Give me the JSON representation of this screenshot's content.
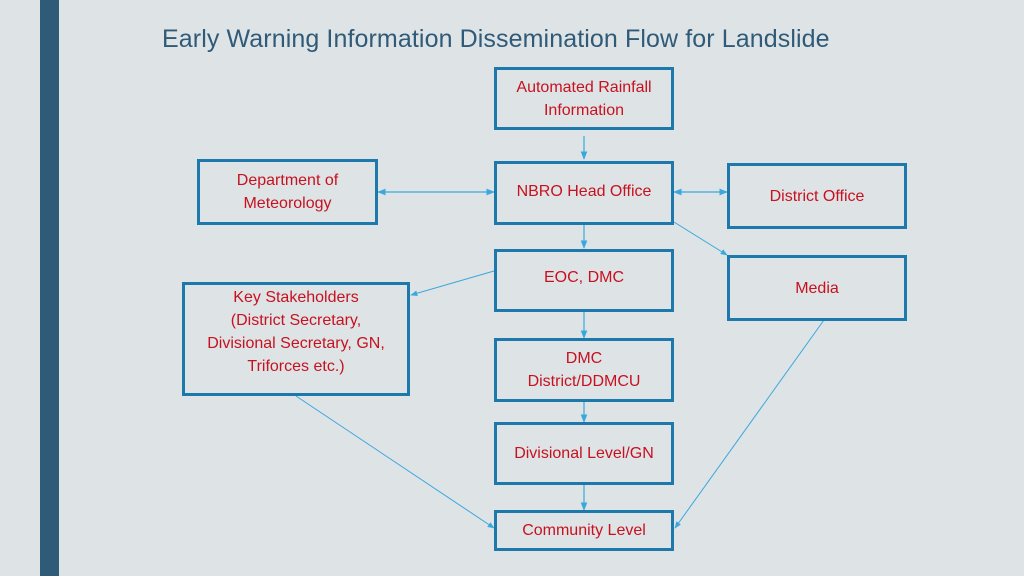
{
  "title": "Early Warning Information Dissemination Flow for Landslide",
  "colors": {
    "accent_bar": "#2f5a78",
    "title_text": "#2f5a78",
    "box_border": "#1d79ab",
    "box_text": "#c8111f",
    "connector": "#3aa8dc",
    "background": "#dee3e6"
  },
  "nodes": {
    "rainfall": "Automated Rainfall\nInformation",
    "meteorology": "Department of\nMeteorology",
    "nbro": "NBRO Head Office",
    "district_office": "District Office",
    "eoc": "EOC, DMC",
    "media": "Media",
    "stakeholders": "Key Stakeholders\n(District Secretary,\nDivisional Secretary, GN,\nTriforces etc.)",
    "ddmcu": "DMC\nDistrict/DDMCU",
    "divisional": "Divisional Level/GN",
    "community": "Community Level"
  },
  "edges": [
    {
      "from": "rainfall",
      "to": "nbro",
      "type": "one-way"
    },
    {
      "from": "meteorology",
      "to": "nbro",
      "type": "two-way"
    },
    {
      "from": "nbro",
      "to": "district_office",
      "type": "two-way"
    },
    {
      "from": "nbro",
      "to": "eoc",
      "type": "one-way"
    },
    {
      "from": "nbro",
      "to": "media",
      "type": "one-way"
    },
    {
      "from": "eoc",
      "to": "stakeholders",
      "type": "one-way"
    },
    {
      "from": "eoc",
      "to": "ddmcu",
      "type": "one-way"
    },
    {
      "from": "ddmcu",
      "to": "divisional",
      "type": "one-way"
    },
    {
      "from": "divisional",
      "to": "community",
      "type": "one-way"
    },
    {
      "from": "stakeholders",
      "to": "community",
      "type": "one-way"
    },
    {
      "from": "media",
      "to": "community",
      "type": "one-way"
    }
  ]
}
